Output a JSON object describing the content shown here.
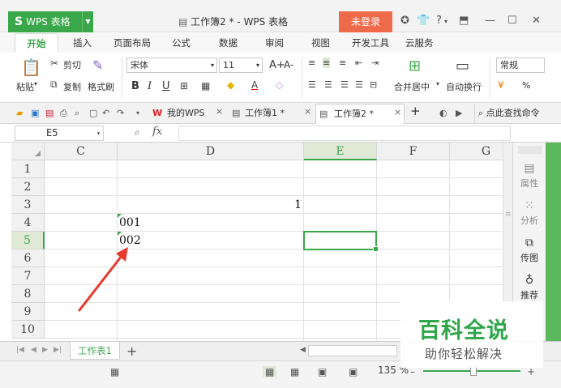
{
  "titlebar": {
    "app_name": "WPS 表格",
    "doc_title": "工作簿2 * - WPS 表格",
    "login_label": "未登录",
    "help_label": "?"
  },
  "menu": {
    "tabs": [
      "开始",
      "插入",
      "页面布局",
      "公式",
      "数据",
      "审阅",
      "视图",
      "开发工具",
      "云服务"
    ],
    "active": "开始"
  },
  "ribbon": {
    "paste": "粘贴",
    "cut": "剪切",
    "copy": "复制",
    "format_painter": "格式刷",
    "font_name": "宋体",
    "font_size": "11",
    "font_grow": "A+",
    "font_shrink": "A-",
    "bold": "B",
    "italic": "I",
    "underline": "U",
    "merge_center": "合并居中",
    "wrap_text": "自动换行",
    "number_format": "常规",
    "percent": "%"
  },
  "doc_tabs": {
    "tab1": "我的WPS",
    "tab2": "工作簿1 *",
    "tab3": "工作簿2 *",
    "close": "×",
    "add": "+",
    "search": "点此查找命令"
  },
  "formula_bar": {
    "cell_ref": "E5",
    "fx": "fx",
    "value": ""
  },
  "grid": {
    "columns": [
      "C",
      "D",
      "E",
      "F",
      "G"
    ],
    "selected_column": "E",
    "rows": [
      "1",
      "2",
      "3",
      "4",
      "5",
      "6",
      "7",
      "8",
      "9",
      "10"
    ],
    "selected_row": "5",
    "cells": {
      "D3": "1",
      "D4": "001",
      "D5": "002"
    }
  },
  "sidebar": {
    "items": [
      "属性",
      "分析",
      "传图",
      "推荐"
    ]
  },
  "sheet_tabs": {
    "active": "工作表1",
    "add": "+"
  },
  "status": {
    "zoom": "135 %",
    "zoom_fraction": 0.52
  },
  "watermark": {
    "title": "百科全说",
    "subtitle": "助你轻松解决"
  },
  "colors": {
    "accent": "#3aa84a",
    "login": "#ee6a4b",
    "arrow": "#e53a2f"
  }
}
